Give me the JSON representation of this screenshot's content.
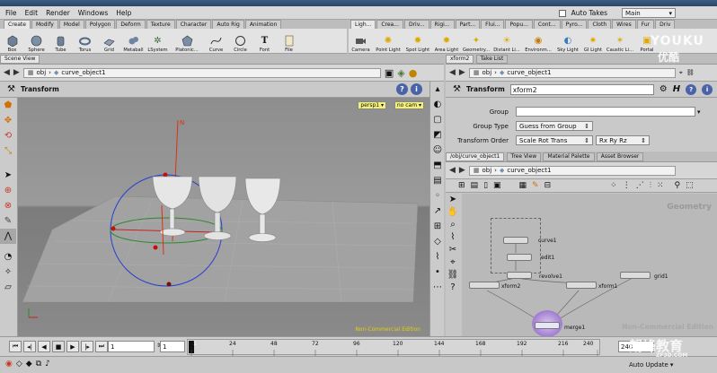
{
  "menu": {
    "items": [
      "File",
      "Edit",
      "Render",
      "Windows",
      "Help"
    ],
    "auto_takes_label": "Auto Takes",
    "desktop_value": "Main"
  },
  "shelf_left": {
    "tabs": [
      "Create",
      "Modify",
      "Model",
      "Polygon",
      "Deform",
      "Texture",
      "Character",
      "Auto Rig",
      "Animation"
    ],
    "tools": [
      "Box",
      "Sphere",
      "Tube",
      "Torus",
      "Grid",
      "Metaball",
      "LSystem",
      "Platonic...",
      "Curve",
      "Circle",
      "Font",
      "File"
    ]
  },
  "shelf_right": {
    "tabs": [
      "Ligh...",
      "Crea...",
      "Driv...",
      "Rigi...",
      "Part...",
      "Flui...",
      "Popu...",
      "Cont...",
      "Pyro...",
      "Cloth",
      "Wires",
      "Fur",
      "Driv"
    ],
    "tools": [
      "Camera",
      "Point Light",
      "Spot Light",
      "Area Light",
      "Geometry...",
      "Distant Li...",
      "Environm...",
      "Sky Light",
      "GI Light",
      "Caustic Li...",
      "Portal"
    ]
  },
  "scene_view": {
    "tab_label": "Scene View",
    "path_root": "obj",
    "path_node": "curve_object1",
    "header_title": "Transform",
    "persp_label": "persp1 ▾",
    "cam_label": "no cam ▾",
    "watermark": "Non-Commercial Edition",
    "axis_label": "N"
  },
  "parm_pane": {
    "tabs": [
      "xform2",
      "Take List"
    ],
    "path_root": "obj",
    "path_node": "curve_object1",
    "node_type": "Transform",
    "node_name": "xform2",
    "help_label": "H",
    "rows": [
      {
        "label": "Group",
        "value": ""
      },
      {
        "label": "Group Type",
        "value": "Guess from Group"
      },
      {
        "label": "Transform Order",
        "value": "Scale Rot Trans",
        "value2": "Rx Ry Rz"
      }
    ]
  },
  "network": {
    "tabs": [
      "/obj/curve_object1",
      "Tree View",
      "Material Palette",
      "Asset Browser"
    ],
    "path_root": "obj",
    "path_node": "curve_object1",
    "context_label": "Geometry",
    "watermark": "Non-Commercial Edition",
    "nodes": [
      "curve1",
      "edit1",
      "revolve1",
      "xform2",
      "xform1",
      "grid1",
      "merge1"
    ]
  },
  "playbar": {
    "start_frame": "1",
    "current_frame": "1",
    "end_frame": "240",
    "ticks": [
      "1",
      "24",
      "48",
      "72",
      "96",
      "120",
      "144",
      "168",
      "192",
      "216",
      "240"
    ]
  },
  "status": {
    "auto_update_label": "Auto Update"
  },
  "overlay_watermarks": {
    "top_right_logo": "YOUKU",
    "top_right_sub": "优酷",
    "bottom_right": "朗峰教育",
    "bottom_right_small": "ZF3D.COM"
  }
}
